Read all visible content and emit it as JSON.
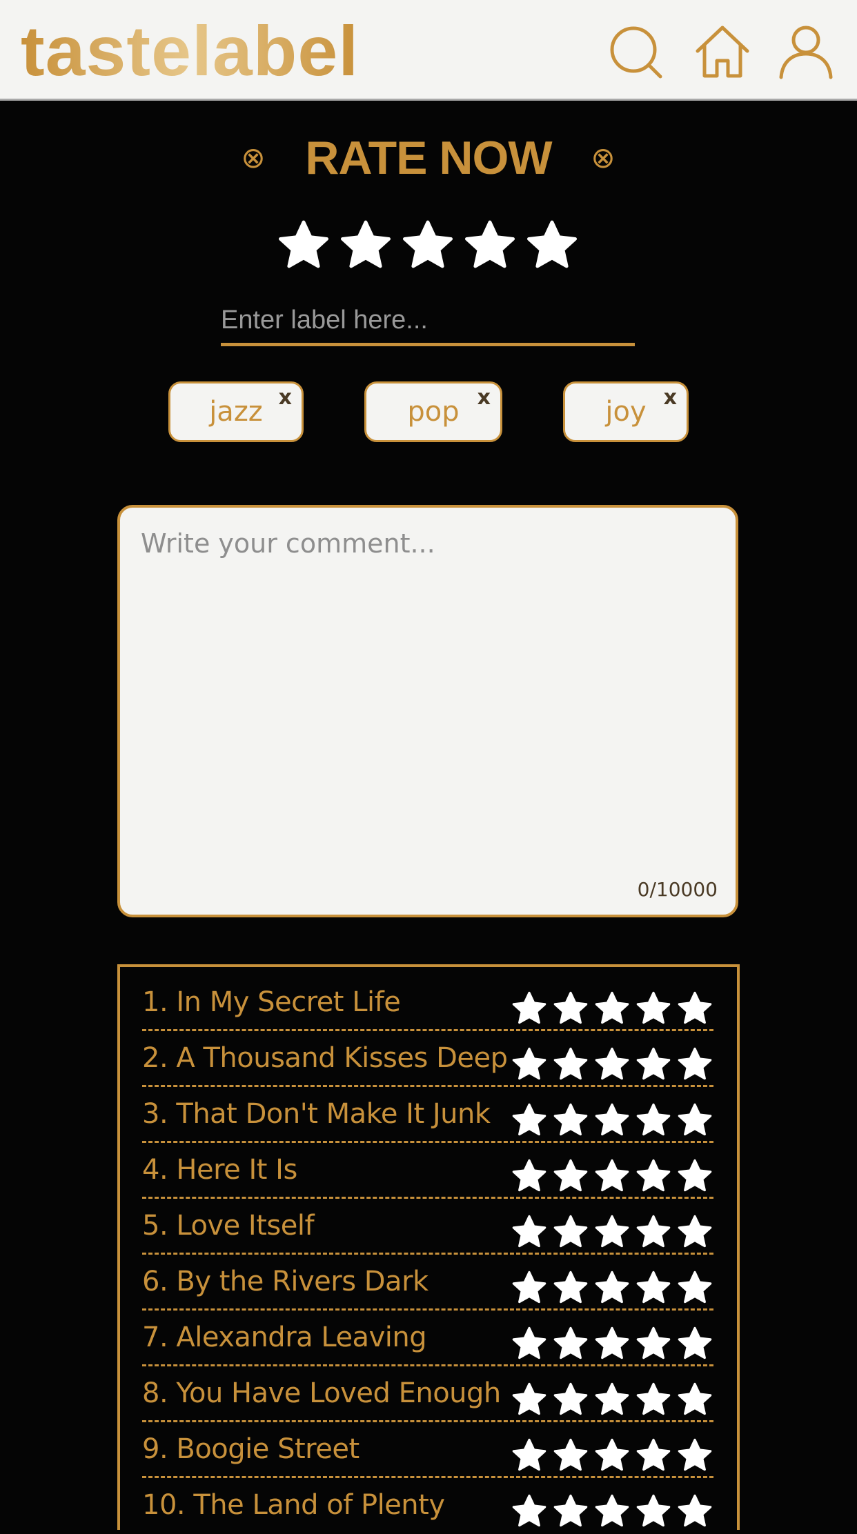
{
  "header": {
    "logo": "tastelabel",
    "icons": [
      "search-icon",
      "home-icon",
      "user-icon"
    ]
  },
  "rate": {
    "title": "RATE NOW",
    "rating": 5,
    "max_rating": 5
  },
  "label_input": {
    "placeholder": "Enter label here...",
    "value": ""
  },
  "tags": [
    {
      "label": "jazz",
      "remove": "x"
    },
    {
      "label": "pop",
      "remove": "x"
    },
    {
      "label": "joy",
      "remove": "x"
    }
  ],
  "comment": {
    "placeholder": "Write your comment...",
    "counter": "0/10000"
  },
  "tracks": [
    {
      "title": "1. In My Secret Life",
      "rating": 5
    },
    {
      "title": "2. A Thousand Kisses Deep",
      "rating": 5
    },
    {
      "title": "3. That Don't Make It Junk",
      "rating": 5
    },
    {
      "title": "4. Here It Is",
      "rating": 5
    },
    {
      "title": "5. Love Itself",
      "rating": 5
    },
    {
      "title": "6. By the Rivers Dark",
      "rating": 5
    },
    {
      "title": "7. Alexandra Leaving",
      "rating": 5
    },
    {
      "title": "8. You Have Loved Enough",
      "rating": 5
    },
    {
      "title": "9. Boogie Street",
      "rating": 5
    },
    {
      "title": "10. The Land of Plenty",
      "rating": 5
    }
  ],
  "colors": {
    "accent": "#c8913b",
    "background": "#050505",
    "header_bg": "#f4f4f2",
    "star": "#ffffff"
  }
}
